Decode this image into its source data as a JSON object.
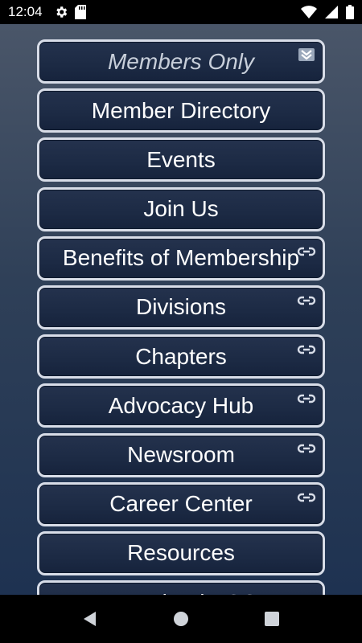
{
  "status_bar": {
    "time": "12:04",
    "left_icons": [
      "gear-icon",
      "sd-card-icon"
    ],
    "right_icons": [
      "wifi-icon",
      "signal-icon",
      "battery-icon"
    ]
  },
  "menu": {
    "header": {
      "label": "Members Only",
      "icon": "double-chevron-down-icon"
    },
    "items": [
      {
        "label": "Member Directory",
        "external_link": false
      },
      {
        "label": "Events",
        "external_link": false
      },
      {
        "label": "Join Us",
        "external_link": false
      },
      {
        "label": "Benefits of Membership",
        "external_link": true
      },
      {
        "label": "Divisions",
        "external_link": true
      },
      {
        "label": "Chapters",
        "external_link": true
      },
      {
        "label": "Advocacy Hub",
        "external_link": true
      },
      {
        "label": "Newsroom",
        "external_link": true
      },
      {
        "label": "Career Center",
        "external_link": true
      },
      {
        "label": "Resources",
        "external_link": false
      },
      {
        "label": "Download PSC",
        "external_link": false
      }
    ]
  },
  "nav_bar": {
    "buttons": [
      "back-icon",
      "home-icon",
      "recents-icon"
    ]
  },
  "colors": {
    "button_border": "#d8dde8",
    "button_fill": "#1c2a44",
    "background_top": "#4a5669",
    "background_bottom": "#1e3251"
  }
}
